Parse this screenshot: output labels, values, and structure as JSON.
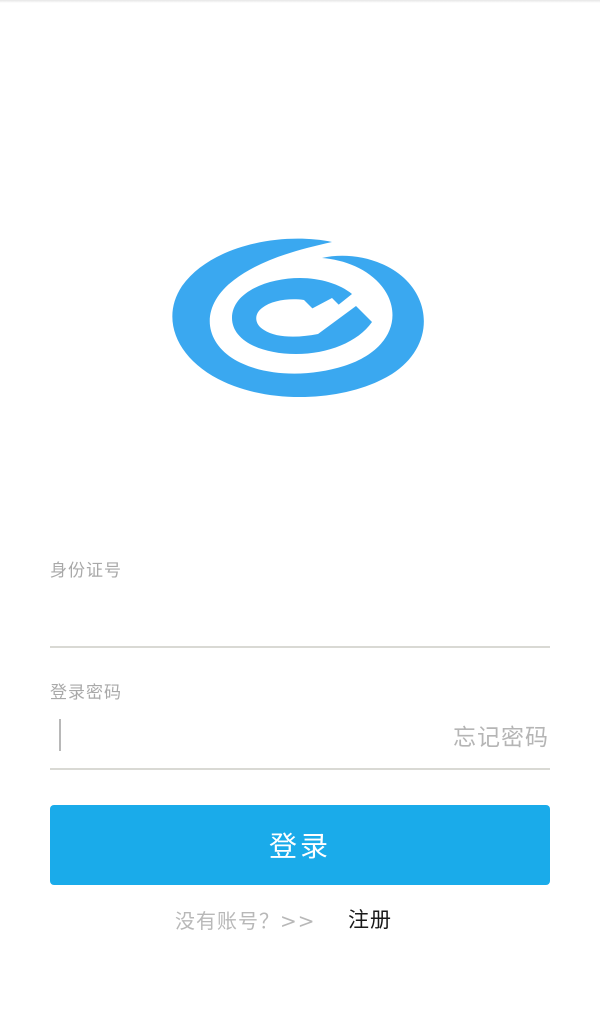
{
  "form": {
    "id_label": "身份证号",
    "id_value": "",
    "password_label": "登录密码",
    "password_value": "",
    "forgot_password": "忘记密码",
    "login_button": "登录"
  },
  "footer": {
    "no_account_text": "没有账号？>>",
    "register_link": "注册"
  },
  "colors": {
    "brand": "#3aa8f0",
    "button": "#1aabea",
    "label": "#a9a9a9",
    "divider": "#d9d9d4"
  },
  "icons": {
    "logo": "spiral-logo-icon"
  }
}
